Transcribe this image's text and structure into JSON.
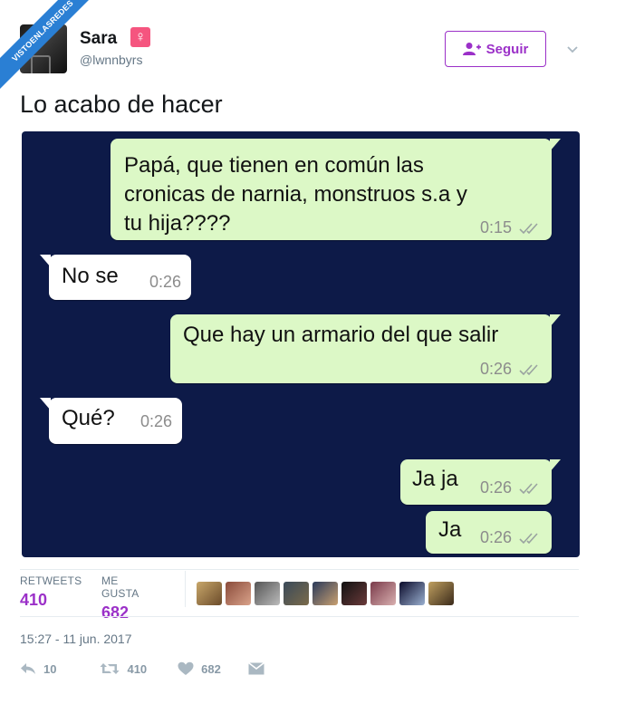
{
  "watermark": "VISTOENLASREDES",
  "user": {
    "name": "Sara",
    "gender_symbol": "♀",
    "handle": "@lwnnbyrs",
    "follow_label": "Seguir"
  },
  "tweet": {
    "text": "Lo acabo de hacer",
    "timestamp": "15:27 - 11 jun. 2017"
  },
  "chat": {
    "messages": [
      {
        "direction": "out",
        "lines": [
          "Papá, que tienen en común las",
          "cronicas de narnia, monstruos s.a y",
          "tu hija????"
        ],
        "time": "0:15"
      },
      {
        "direction": "in",
        "lines": [
          "No se"
        ],
        "time": "0:26"
      },
      {
        "direction": "out",
        "lines": [
          "Que hay un armario del que salir"
        ],
        "time": "0:26"
      },
      {
        "direction": "in",
        "lines": [
          "Qué?"
        ],
        "time": "0:26"
      },
      {
        "direction": "out",
        "lines": [
          "Ja ja"
        ],
        "time": "0:26"
      },
      {
        "direction": "out",
        "lines": [
          "Ja"
        ],
        "time": "0:26"
      }
    ]
  },
  "stats": {
    "retweets_label": "RETWEETS",
    "retweets_value": "410",
    "likes_label": "ME GUSTA",
    "likes_value": "682"
  },
  "actions": {
    "reply_count": "10",
    "retweet_count": "410",
    "like_count": "682"
  },
  "colors": {
    "accent": "#9b30c8",
    "chat_bg": "#0d1a48",
    "bubble_out": "#dcf8c6",
    "bubble_in": "#ffffff",
    "gender_badge": "#f5557f",
    "watermark_bg": "#2a7fd4"
  }
}
